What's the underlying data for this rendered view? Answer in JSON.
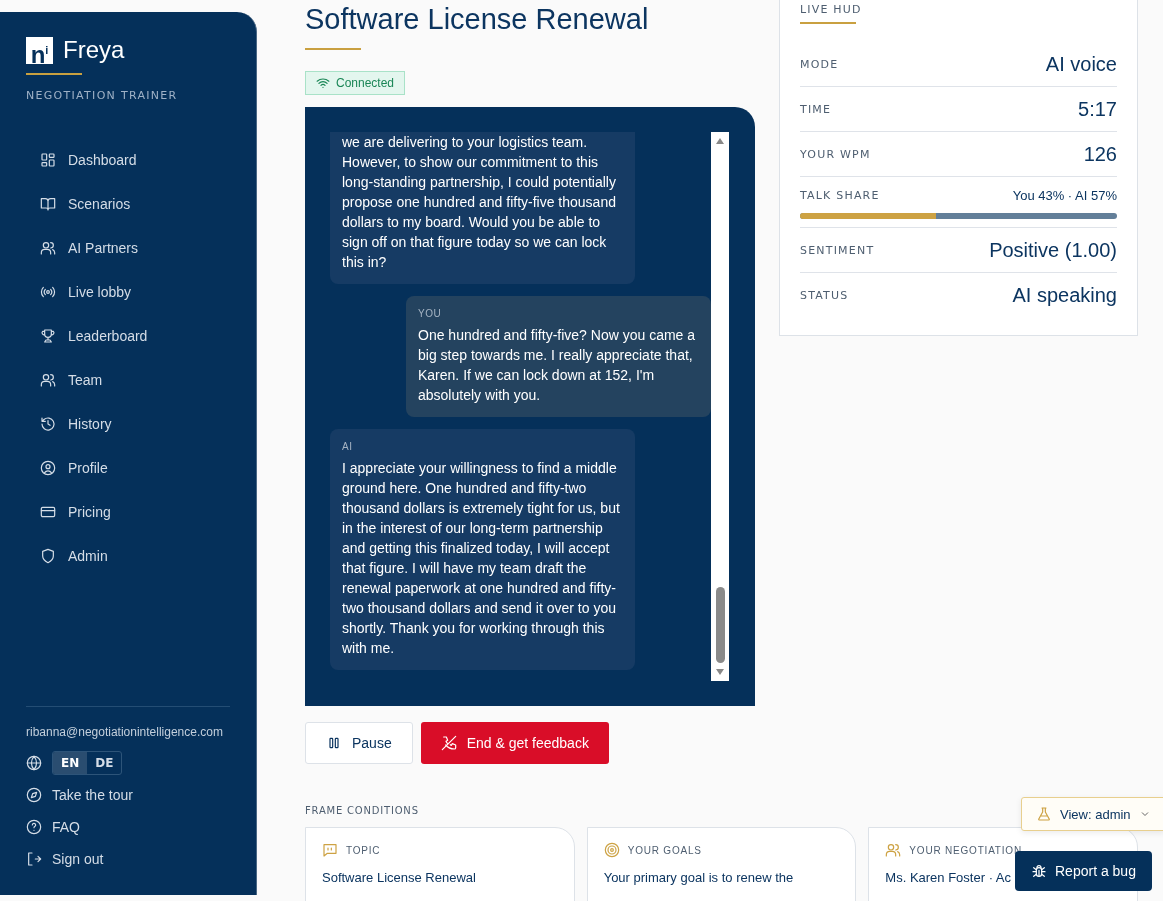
{
  "brand": {
    "logo": "n$^{i}$",
    "name": "Freya",
    "subtitle": "NEGOTIATION TRAINER"
  },
  "nav": [
    {
      "label": "Dashboard"
    },
    {
      "label": "Scenarios"
    },
    {
      "label": "AI Partners"
    },
    {
      "label": "Live lobby"
    },
    {
      "label": "Leaderboard"
    },
    {
      "label": "Team"
    },
    {
      "label": "History"
    },
    {
      "label": "Profile"
    },
    {
      "label": "Pricing"
    },
    {
      "label": "Admin"
    }
  ],
  "account": {
    "email": "ribanna@negotiationintelligence.com",
    "languages": [
      {
        "label": "EN",
        "selected": true
      },
      {
        "label": "DE",
        "selected": false
      }
    ],
    "links": [
      {
        "label": "Take the tour"
      },
      {
        "label": "FAQ"
      },
      {
        "label": "Sign out"
      }
    ]
  },
  "title": "Software License Renewal",
  "connection": {
    "label": "Connected"
  },
  "messages": [
    {
      "kind": "ai",
      "text": "we are delivering to your logistics team. However, to show our commitment to this long-standing partnership, I could potentially propose one hundred and fifty-five thousand dollars to my board. Would you be able to sign off on that figure today so we can lock this in?"
    },
    {
      "kind": "you",
      "label": "YOU",
      "text": "One hundred and fifty-five? Now you came a big step towards me. I really appreciate that, Karen. If we can lock down at 152, I'm absolutely with you."
    },
    {
      "kind": "ai",
      "label": "AI",
      "text": "I appreciate your willingness to find a middle ground here. One hundred and fifty-two thousand dollars is extremely tight for us, but in the interest of our long-term partnership and getting this finalized today, I will accept that figure. I will have my team draft the renewal paperwork at one hundred and fifty-two thousand dollars and send it over to you shortly. Thank you for working through this with me."
    }
  ],
  "controls": [
    {
      "kind": "pause",
      "label": "Pause"
    },
    {
      "kind": "end",
      "label": "End & get feedback"
    }
  ],
  "hud": {
    "title": "LIVE HUD",
    "rows": [
      {
        "kind": "stat",
        "label": "MODE",
        "value": "AI voice"
      },
      {
        "kind": "stat",
        "label": "TIME",
        "value": "5:17"
      },
      {
        "kind": "stat",
        "label": "YOUR WPM",
        "value": "126"
      },
      {
        "kind": "share",
        "label": "TALK SHARE",
        "value": "You 43% · AI 57%",
        "level": 0.43
      },
      {
        "kind": "stat",
        "label": "SENTIMENT",
        "value": "Positive (1.00)"
      },
      {
        "kind": "stat",
        "label": "STATUS",
        "value": "AI speaking"
      }
    ]
  },
  "frame": {
    "title": "FRAME CONDITIONS",
    "cards": [
      {
        "label": "TOPIC",
        "text": "Software License Renewal"
      },
      {
        "label": "YOUR GOALS",
        "text": "Your primary goal is to renew the"
      },
      {
        "label": "YOUR NEGOTIATION",
        "text": "Ms. Karen Foster · Ac"
      }
    ]
  },
  "view_menu": {
    "label": "View: admin"
  },
  "bug_button": {
    "label": "Report a bug"
  }
}
